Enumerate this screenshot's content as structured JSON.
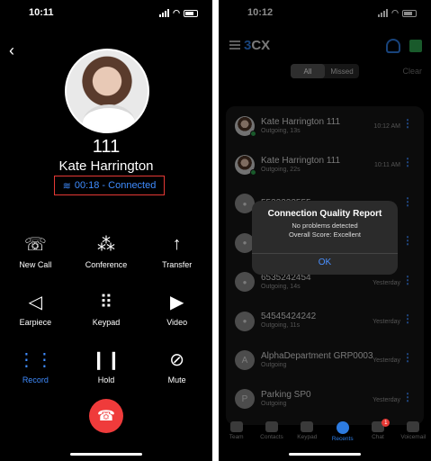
{
  "left": {
    "status_time": "10:11",
    "extension": "111",
    "contact_name": "Kate Harrington",
    "call_status": "00:18 - Connected",
    "controls": [
      {
        "label": "New Call",
        "icon": "add-person-icon",
        "active": false
      },
      {
        "label": "Conference",
        "icon": "group-icon",
        "active": false
      },
      {
        "label": "Transfer",
        "icon": "transfer-icon",
        "active": false
      },
      {
        "label": "Earpiece",
        "icon": "speaker-icon",
        "active": false
      },
      {
        "label": "Keypad",
        "icon": "keypad-icon",
        "active": false
      },
      {
        "label": "Video",
        "icon": "video-icon",
        "active": false
      },
      {
        "label": "Record",
        "icon": "waveform-icon",
        "active": true
      },
      {
        "label": "Hold",
        "icon": "pause-icon",
        "active": false
      },
      {
        "label": "Mute",
        "icon": "mic-off-icon",
        "active": false
      }
    ]
  },
  "right": {
    "status_time": "10:12",
    "logo": "3CX",
    "filters": [
      "All",
      "Missed"
    ],
    "clear_label": "Clear",
    "calls": [
      {
        "name": "Kate Harrington 111",
        "detail": "Outgoing, 13s",
        "when": "10:12 AM",
        "avatar": "photo",
        "initial": ""
      },
      {
        "name": "Kate Harrington 111",
        "detail": "Outgoing, 22s",
        "when": "10:11 AM",
        "avatar": "photo",
        "initial": ""
      },
      {
        "name": "5532222555",
        "detail": "",
        "when": "",
        "avatar": "person",
        "initial": ""
      },
      {
        "name": "",
        "detail": "",
        "when": "",
        "avatar": "person",
        "initial": ""
      },
      {
        "name": "6535242454",
        "detail": "Outgoing, 14s",
        "when": "Yesterday",
        "avatar": "person",
        "initial": ""
      },
      {
        "name": "54545424242",
        "detail": "Outgoing, 11s",
        "when": "Yesterday",
        "avatar": "person",
        "initial": ""
      },
      {
        "name": "AlphaDepartment GRP0003",
        "detail": "Outgoing",
        "when": "Yesterday",
        "avatar": "letter",
        "initial": "A"
      },
      {
        "name": "Parking SP0",
        "detail": "Outgoing",
        "when": "Yesterday",
        "avatar": "letter",
        "initial": "P"
      }
    ],
    "dialog": {
      "title": "Connection Quality Report",
      "line1": "No problems detected",
      "line2": "Overall Score: Excellent",
      "ok": "OK"
    },
    "tabs": [
      {
        "label": "Team",
        "active": false
      },
      {
        "label": "Contacts",
        "active": false
      },
      {
        "label": "Keypad",
        "active": false
      },
      {
        "label": "Recents",
        "active": true
      },
      {
        "label": "Chat",
        "active": false,
        "badge": "1"
      },
      {
        "label": "Voicemail",
        "active": false
      }
    ]
  },
  "colors": {
    "accent": "#3f8cff",
    "hangup": "#ef3b3b",
    "highlight_box": "#e53935"
  }
}
